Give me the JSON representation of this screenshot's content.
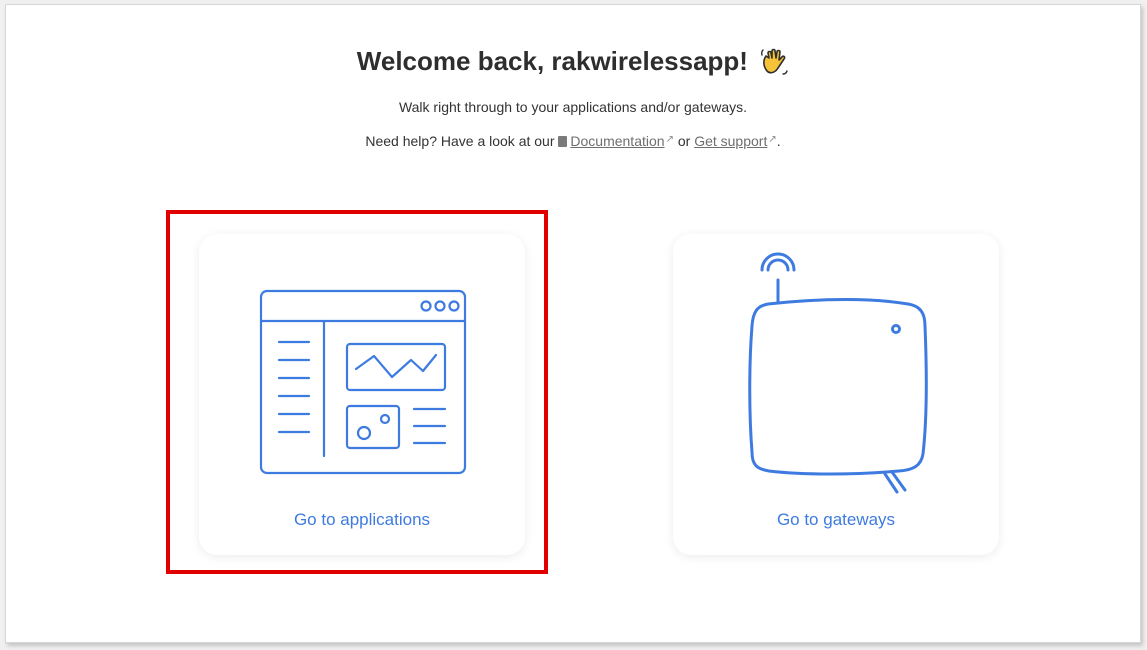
{
  "header": {
    "welcome": "Welcome back, rakwirelessapp!",
    "subtitle": "Walk right through to your applications and/or gateways.",
    "help_prefix": "Need help? Have a look at our",
    "documentation_link": "Documentation",
    "or": "or",
    "support_link": "Get support",
    "help_suffix": "."
  },
  "cards": {
    "applications": {
      "label": "Go to applications",
      "icon": "applications-dashboard-icon"
    },
    "gateways": {
      "label": "Go to gateways",
      "icon": "gateway-device-icon"
    }
  },
  "colors": {
    "accent": "#3e7be0",
    "highlight": "#e00000",
    "text": "#2e2e2e"
  }
}
